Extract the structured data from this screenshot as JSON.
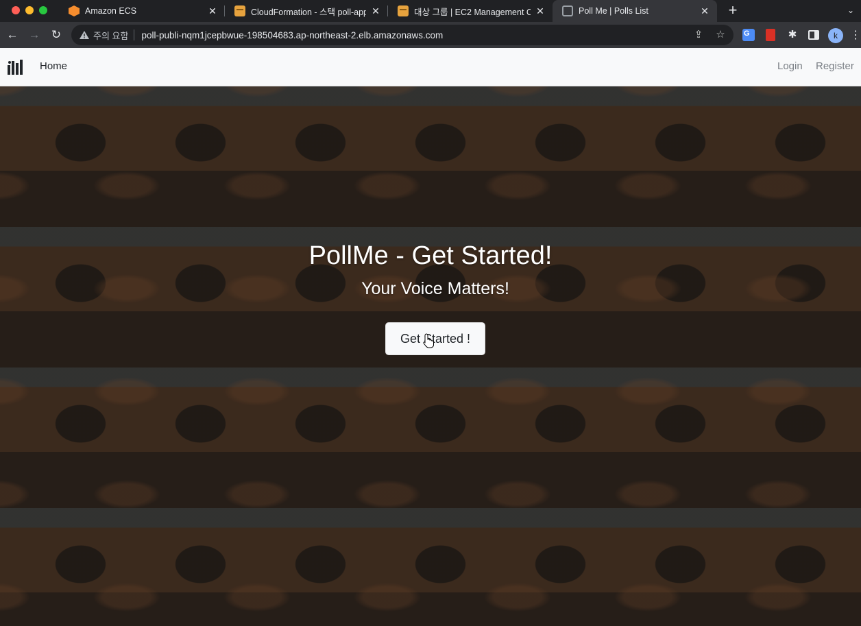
{
  "browser": {
    "tabs": [
      {
        "title": "Amazon ECS",
        "icon": "ecs-icon",
        "active": false
      },
      {
        "title": "CloudFormation - 스택 poll-app",
        "icon": "cloudformation-icon",
        "active": false
      },
      {
        "title": "대상 그룹 | EC2 Management Co",
        "icon": "ec2-icon",
        "active": false
      },
      {
        "title": "Poll Me | Polls List",
        "icon": "globe-icon",
        "active": true
      }
    ],
    "security_warning": "주의 요함",
    "url": "poll-publi-nqm1jcepbwue-198504683.ap-northeast-2.elb.amazonaws.com",
    "profile_initial": "k"
  },
  "site_nav": {
    "home_label": "Home",
    "login_label": "Login",
    "register_label": "Register"
  },
  "hero": {
    "title": "PollMe - Get Started!",
    "subtitle": "Your Voice Matters!",
    "button_label": "Get Started !"
  }
}
